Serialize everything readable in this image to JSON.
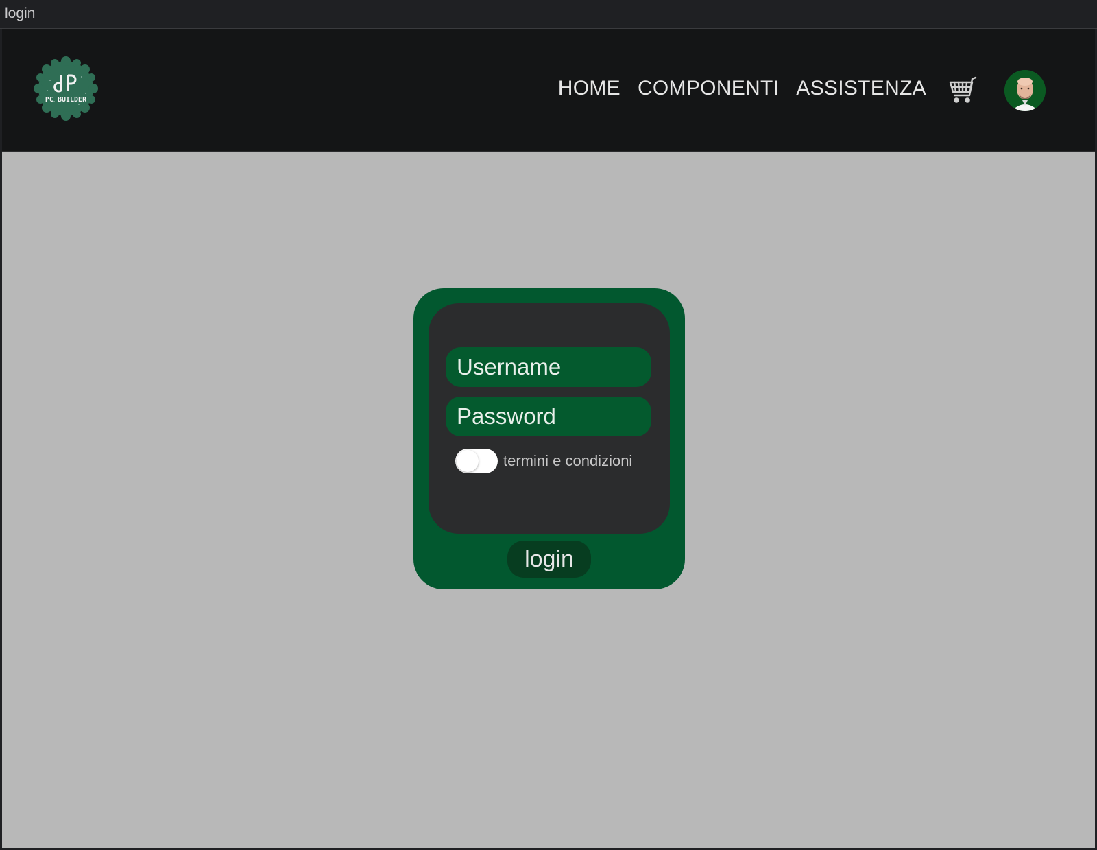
{
  "window": {
    "title": "login"
  },
  "navbar": {
    "logo_icon": "pc-builder-logo-icon",
    "logo_text": "PC BUILDER",
    "links": [
      {
        "label": "HOME"
      },
      {
        "label": "COMPONENTI"
      },
      {
        "label": "ASSISTENZA"
      }
    ],
    "cart_icon": "shopping-cart-icon",
    "avatar_icon": "user-avatar-icon"
  },
  "login_form": {
    "username_placeholder": "Username",
    "password_placeholder": "Password",
    "terms_label": "termini e condizioni",
    "terms_checked": false,
    "submit_label": "login"
  },
  "colors": {
    "navbar_bg": "#141516",
    "page_bg": "#b8b8b8",
    "card_green": "#02582f",
    "panel_dark": "#2b2c2d",
    "field_green": "#045a2e",
    "button_dark_green": "#073d20"
  }
}
